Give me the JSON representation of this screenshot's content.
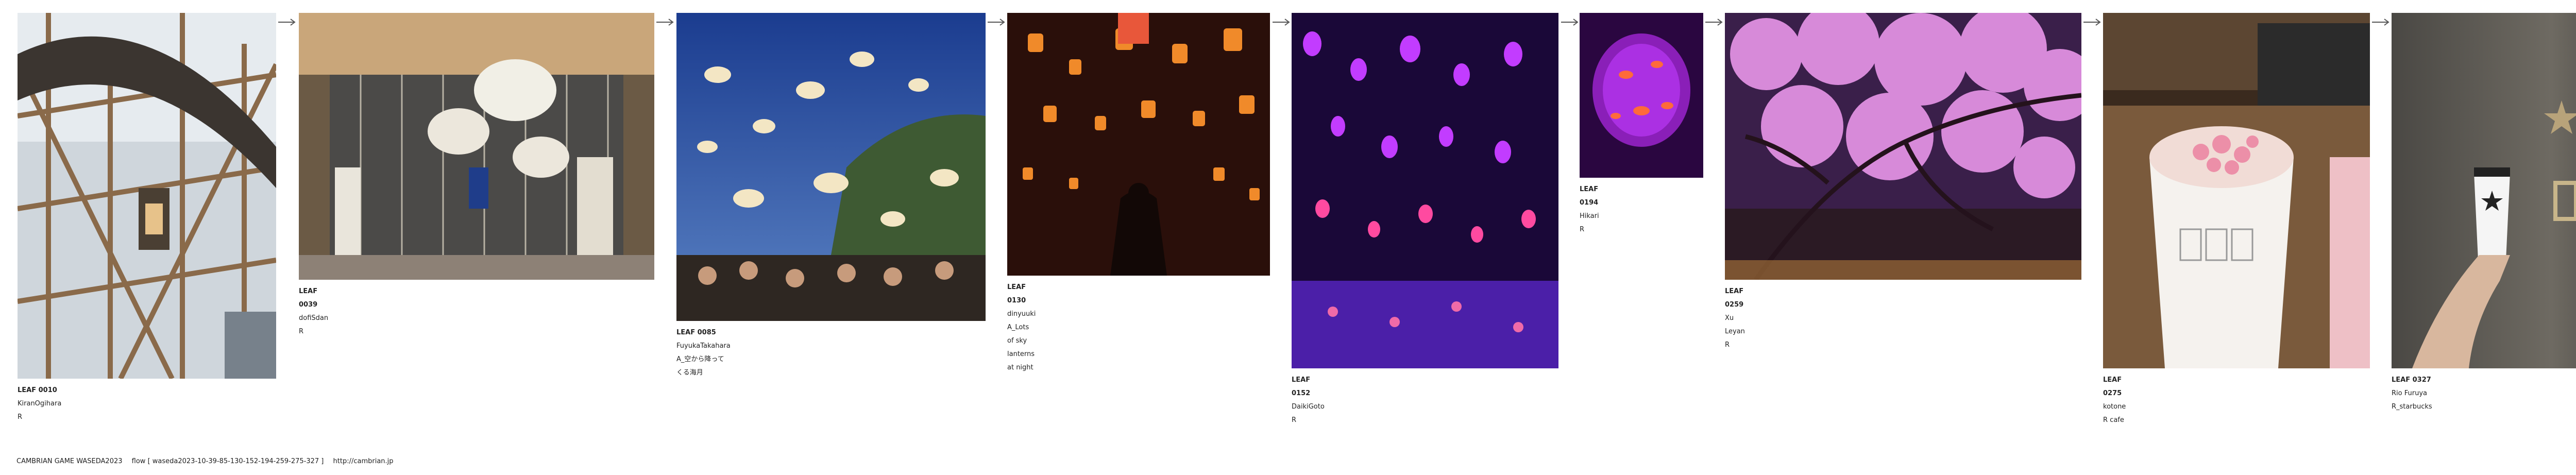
{
  "cards": [
    {
      "id": "LEAF 0010",
      "author": "KiranOgihara",
      "title": "R"
    },
    {
      "id": "LEAF 0039",
      "author": "dofiSdan",
      "title": "R"
    },
    {
      "id": "LEAF 0085",
      "author": "FuyukaTakahara",
      "title": "A_空から降ってくる海月"
    },
    {
      "id": "LEAF 0130",
      "author": "dinyuuki",
      "title": "A_Lots of sky lanterns at night"
    },
    {
      "id": "LEAF 0152",
      "author": "DaikiGoto",
      "title": "R"
    },
    {
      "id": "LEAF 0194",
      "author": "Hikari",
      "title": "R"
    },
    {
      "id": "LEAF 0259",
      "author": "Xu Leyan",
      "title": "R"
    },
    {
      "id": "LEAF 0275",
      "author": "kotone",
      "title": "R cafe"
    },
    {
      "id": "LEAF 0327",
      "author": "Rio Furuya",
      "title": "R_starbucks"
    }
  ],
  "footer": {
    "brand": "CAMBRIAN GAME  WASEDA2023",
    "flow": "flow [ waseda2023-10-39-85-130-152-194-259-275-327 ]",
    "url": "http://cambrian.jp"
  }
}
